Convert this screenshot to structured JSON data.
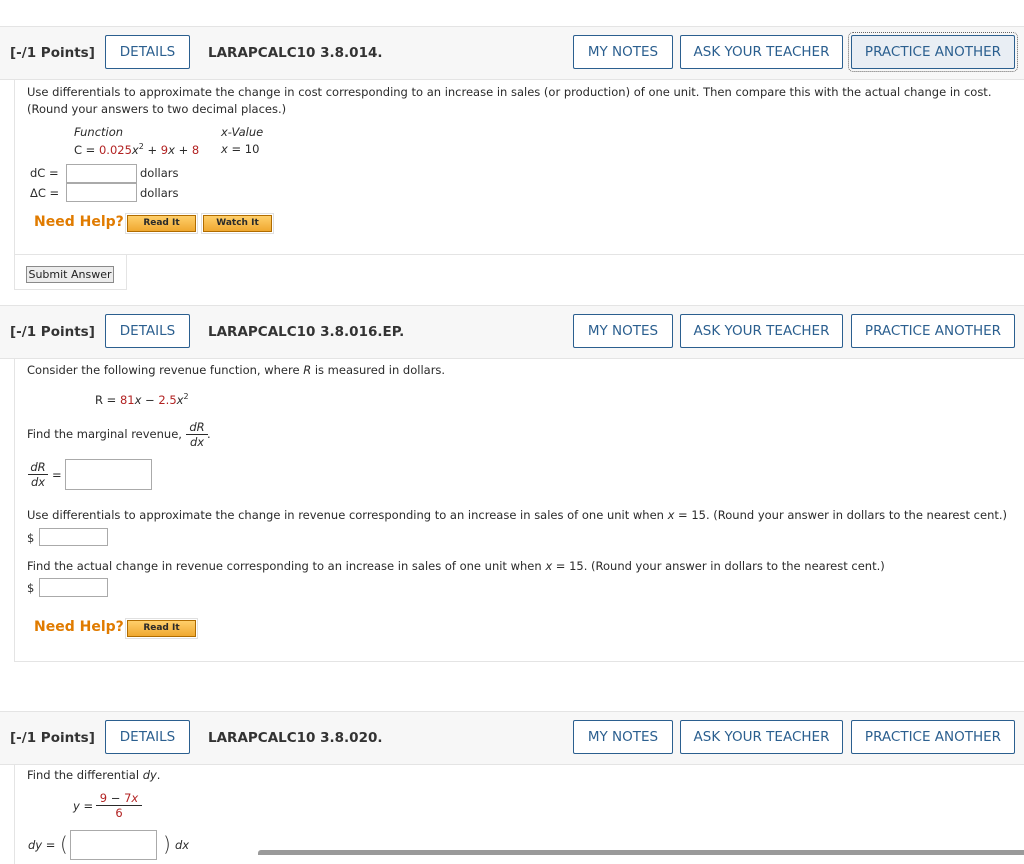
{
  "q1": {
    "points": "[-/1 Points]",
    "details": "DETAILS",
    "code": "LARAPCALC10 3.8.014.",
    "my_notes": "MY NOTES",
    "ask": "ASK YOUR TEACHER",
    "practice": "PRACTICE ANOTHER",
    "prompt1": "Use differentials to approximate the change in cost corresponding to an increase in sales (or production) of one unit. Then compare this with the actual change in cost.",
    "prompt2": "(Round your answers to two decimal places.)",
    "col_function": "Function",
    "col_xvalue": "x-Value",
    "func_prefix": "C = ",
    "func_coef1": "0.025",
    "func_x": "x",
    "func_exp": "2",
    "func_plus1": " + ",
    "func_coef2": "9",
    "func_x2": "x",
    "func_plus2": " + ",
    "func_const": "8",
    "xval_var": "x",
    "xval_rest": " = 10",
    "dc_label": "dC =",
    "delta_label": "ΔC =",
    "unit1": "dollars",
    "unit2": "dollars",
    "need_help": "Need Help?",
    "read_it": "Read It",
    "watch_it": "Watch It",
    "submit": "Submit Answer"
  },
  "q2": {
    "points": "[-/1 Points]",
    "details": "DETAILS",
    "code": "LARAPCALC10 3.8.016.EP.",
    "my_notes": "MY NOTES",
    "ask": "ASK YOUR TEACHER",
    "practice": "PRACTICE ANOTHER",
    "intro_a": "Consider the following revenue function, where ",
    "intro_var": "R",
    "intro_b": " is measured in dollars.",
    "eq_lhs": "R = ",
    "eq_c1": "81",
    "eq_x1": "x",
    "eq_minus": " − ",
    "eq_c2": "2.5",
    "eq_x2": "x",
    "eq_exp": "2",
    "find_marginal": "Find the marginal revenue, ",
    "dR": "dR",
    "dx": "dx",
    "period": ".",
    "eq_sign": "=",
    "prompt_diff_a": "Use differentials to approximate the change in revenue corresponding to an increase in sales of one unit when ",
    "prompt_diff_var": "x",
    "prompt_diff_b": " = 15. (Round your answer in dollars to the nearest cent.)",
    "dollar1": "$",
    "prompt_actual_a": "Find the actual change in revenue corresponding to an increase in sales of one unit when ",
    "prompt_actual_var": "x",
    "prompt_actual_b": " = 15. (Round your answer in dollars to the nearest cent.)",
    "dollar2": "$",
    "need_help": "Need Help?",
    "read_it": "Read It"
  },
  "q3": {
    "points": "[-/1 Points]",
    "details": "DETAILS",
    "code": "LARAPCALC10 3.8.020.",
    "my_notes": "MY NOTES",
    "ask": "ASK YOUR TEACHER",
    "practice": "PRACTICE ANOTHER",
    "prompt_a": "Find the differential ",
    "prompt_var": "dy",
    "prompt_b": ".",
    "y_lhs": "y =",
    "num_a": "9",
    "num_minus": " − ",
    "num_b": "7",
    "num_x": "x",
    "den": "6",
    "dy_lhs": "dy =",
    "open_paren": "(",
    "close_paren": ")",
    "dx": "dx"
  }
}
